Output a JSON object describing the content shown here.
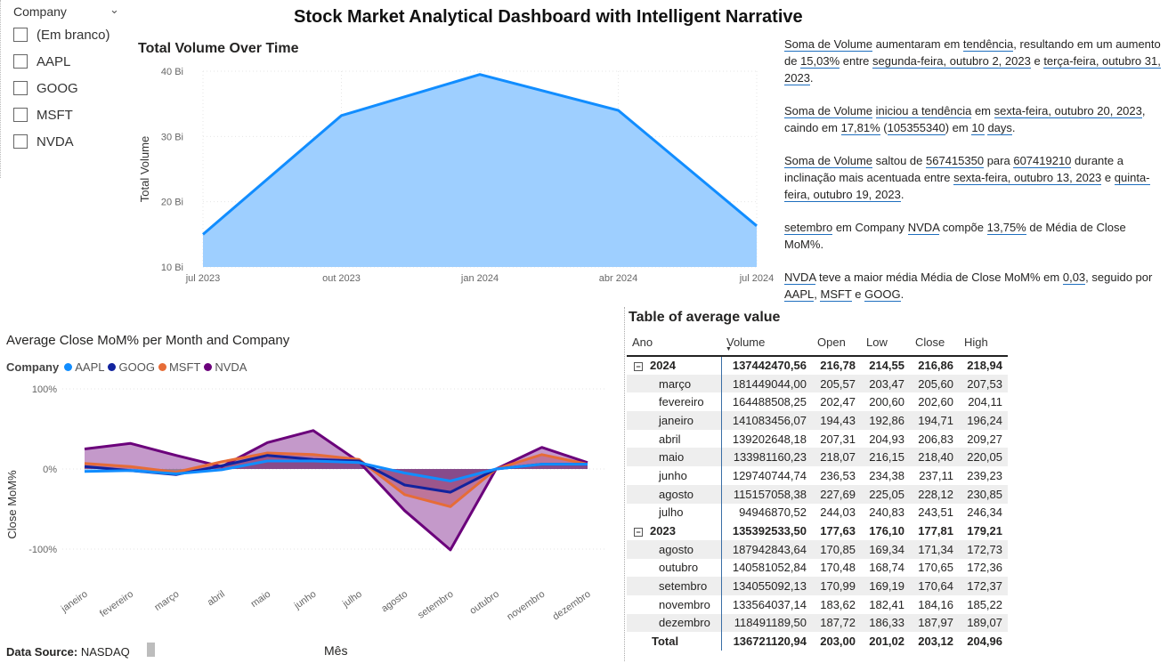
{
  "title": "Stock Market Analytical Dashboard with Intelligent Narrative",
  "slicer": {
    "header": "Company",
    "items": [
      "(Em branco)",
      "AAPL",
      "GOOG",
      "MSFT",
      "NVDA"
    ]
  },
  "narrative": {
    "p1": [
      "Soma de Volume",
      " aumentaram em ",
      "tendência",
      ", resultando em um aumento de ",
      "15,03%",
      " entre ",
      "segunda-feira, outubro 2, 2023",
      " e ",
      "terça-feira, outubro 31, 2023",
      "."
    ],
    "p2": [
      "Soma de Volume",
      " ",
      "iniciou a tendência",
      " em ",
      "sexta-feira, outubro 20, 2023",
      ", caindo em ",
      "17,81%",
      " (",
      "105355340",
      ") em ",
      "10",
      " ",
      "days",
      "."
    ],
    "p3": [
      "Soma de Volume",
      " saltou de ",
      "567415350",
      " para ",
      "607419210",
      " durante a inclinação mais acentuada entre ",
      "sexta-feira, outubro 13, 2023",
      " e ",
      "quinta-feira, outubro 19, 2023",
      "."
    ],
    "p4": [
      "setembro",
      " em Company ",
      "NVDA",
      " compõe ",
      "13,75%",
      " de Média de Close MoM%."
    ],
    "p5": [
      "NVDA",
      " teve a maior média Média de Close MoM% em ",
      "0,03",
      ", seguido por ",
      "AAPL",
      ", ",
      "MSFT",
      " e ",
      "GOOG",
      "."
    ]
  },
  "chart_data": [
    {
      "type": "area",
      "title": "Total Volume Over Time",
      "xlabel": "",
      "ylabel": "Total Volume",
      "x_ticks": [
        "jul 2023",
        "out 2023",
        "jan 2024",
        "abr 2024",
        "jul 2024"
      ],
      "y_ticks": [
        "10 Bi",
        "20 Bi",
        "30 Bi",
        "40 Bi"
      ],
      "ylim": [
        10,
        40
      ],
      "y_unit": "Bi",
      "grid": true,
      "color": "#118DFF",
      "fill": "#9ECFFF",
      "points": [
        {
          "x": "2023-07",
          "y": 15.0
        },
        {
          "x": "2023-10",
          "y": 33.2
        },
        {
          "x": "2024-01",
          "y": 39.5
        },
        {
          "x": "2024-04",
          "y": 34.0
        },
        {
          "x": "2024-07",
          "y": 16.3
        }
      ]
    },
    {
      "type": "area",
      "title": "Average Close MoM% per Month and Company",
      "xlabel": "Mês",
      "ylabel": "Close MoM%",
      "legend_title": "Company",
      "legend_position": "top-left",
      "categories": [
        "janeiro",
        "fevereiro",
        "março",
        "abril",
        "maio",
        "junho",
        "julho",
        "agosto",
        "setembro",
        "outubro",
        "novembro",
        "dezembro"
      ],
      "y_ticks": [
        "100%",
        "0%",
        "-100%"
      ],
      "ylim": [
        -100,
        100
      ],
      "series": [
        {
          "name": "AAPL",
          "color": "#118DFF",
          "values": [
            -3,
            -2,
            -6,
            -1,
            10,
            10,
            8,
            -5,
            -15,
            0,
            6,
            6
          ]
        },
        {
          "name": "GOOG",
          "color": "#12239E",
          "values": [
            3,
            -2,
            -7,
            4,
            17,
            12,
            10,
            -20,
            -29,
            0,
            6,
            6
          ]
        },
        {
          "name": "MSFT",
          "color": "#E66C37",
          "values": [
            7,
            3,
            -4,
            9,
            20,
            18,
            12,
            -32,
            -47,
            0,
            18,
            6
          ]
        },
        {
          "name": "NVDA",
          "color": "#6B007B",
          "values": [
            25,
            32,
            17,
            3,
            33,
            48,
            9,
            -52,
            -101,
            0,
            27,
            8
          ]
        }
      ]
    }
  ],
  "table": {
    "title": "Table of average value",
    "columns": [
      "Ano",
      "Volume",
      "Open",
      "Low",
      "Close",
      "High"
    ],
    "groups": [
      {
        "label": "2024",
        "values": [
          "137442470,56",
          "216,78",
          "214,55",
          "216,86",
          "218,94"
        ],
        "rows": [
          [
            "março",
            "181449044,00",
            "205,57",
            "203,47",
            "205,60",
            "207,53"
          ],
          [
            "fevereiro",
            "164488508,25",
            "202,47",
            "200,60",
            "202,60",
            "204,11"
          ],
          [
            "janeiro",
            "141083456,07",
            "194,43",
            "192,86",
            "194,71",
            "196,24"
          ],
          [
            "abril",
            "139202648,18",
            "207,31",
            "204,93",
            "206,83",
            "209,27"
          ],
          [
            "maio",
            "133981160,23",
            "218,07",
            "216,15",
            "218,40",
            "220,05"
          ],
          [
            "junho",
            "129740744,74",
            "236,53",
            "234,38",
            "237,11",
            "239,23"
          ],
          [
            "agosto",
            "115157058,38",
            "227,69",
            "225,05",
            "228,12",
            "230,85"
          ],
          [
            "julho",
            "94946870,52",
            "244,03",
            "240,83",
            "243,51",
            "246,34"
          ]
        ]
      },
      {
        "label": "2023",
        "values": [
          "135392533,50",
          "177,63",
          "176,10",
          "177,81",
          "179,21"
        ],
        "rows": [
          [
            "agosto",
            "187942843,64",
            "170,85",
            "169,34",
            "171,34",
            "172,73"
          ],
          [
            "outubro",
            "140581052,84",
            "170,48",
            "168,74",
            "170,65",
            "172,36"
          ],
          [
            "setembro",
            "134055092,13",
            "170,99",
            "169,19",
            "170,64",
            "172,37"
          ],
          [
            "novembro",
            "133564037,14",
            "183,62",
            "182,41",
            "184,16",
            "185,22"
          ],
          [
            "dezembro",
            "118491189,50",
            "187,72",
            "186,33",
            "187,97",
            "189,07"
          ]
        ]
      }
    ],
    "total": [
      "Total",
      "136721120,94",
      "203,00",
      "201,02",
      "203,12",
      "204,96"
    ]
  },
  "footer": {
    "label": "Data Source:",
    "value": "NASDAQ"
  }
}
